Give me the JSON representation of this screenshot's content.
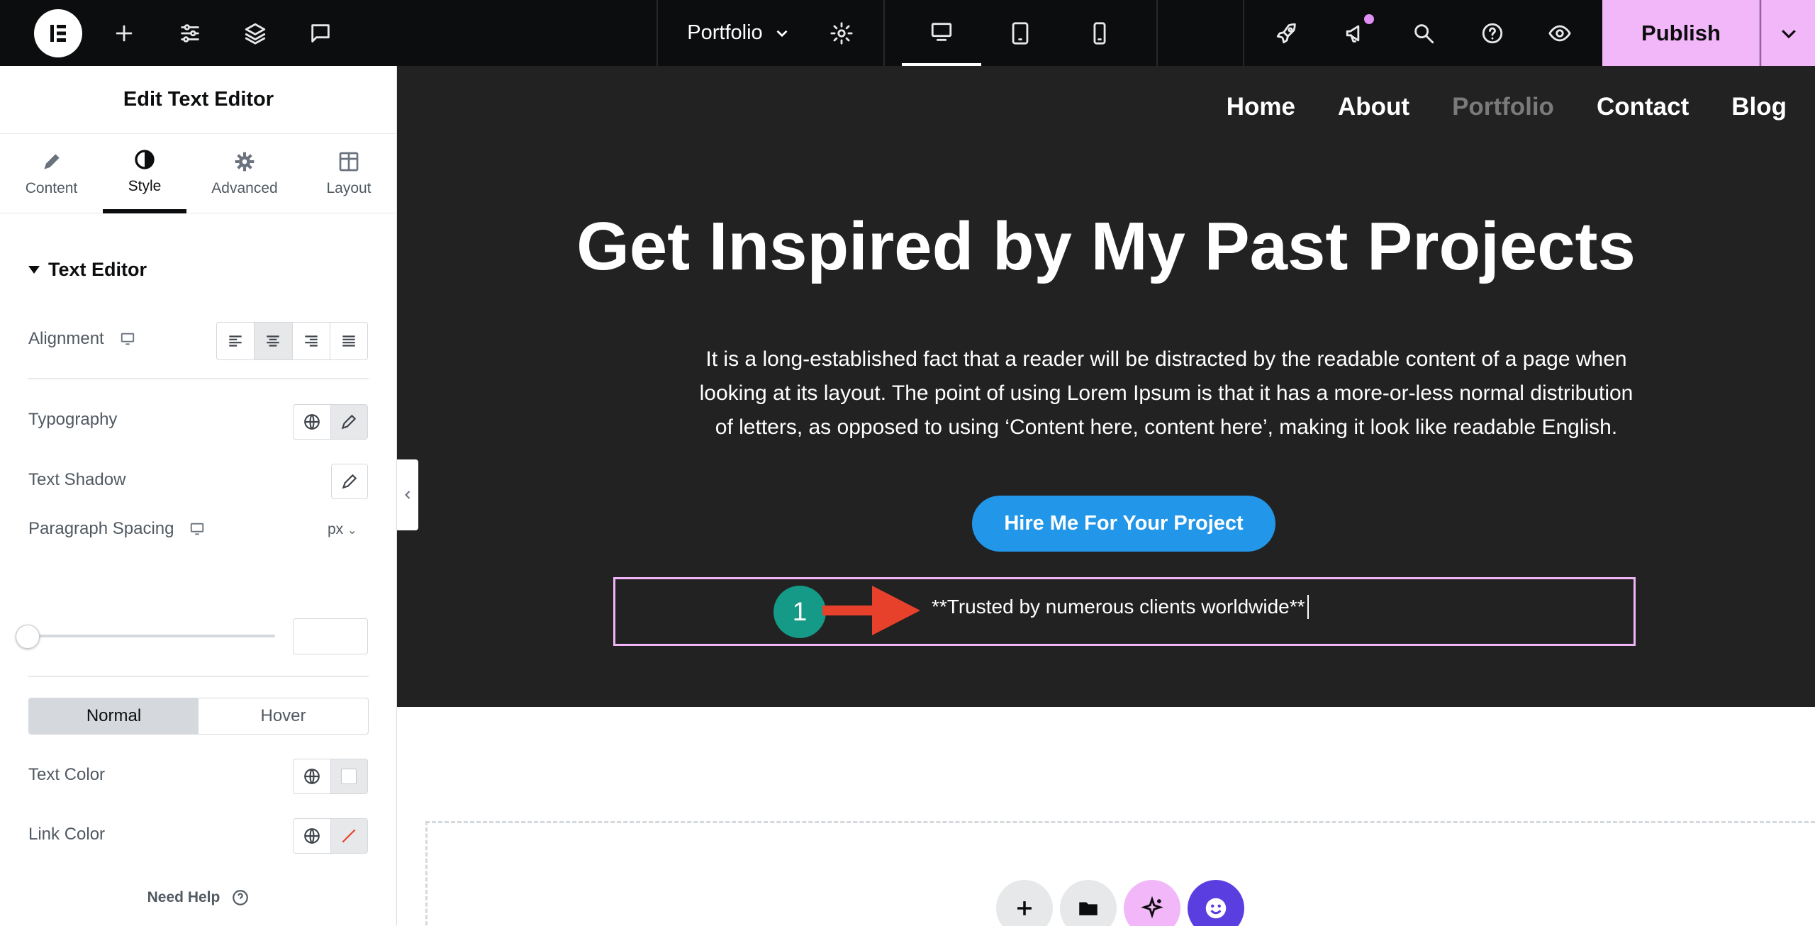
{
  "topbar": {
    "page_name": "Portfolio",
    "publish_label": "Publish"
  },
  "panel": {
    "title": "Edit Text Editor",
    "tabs": [
      {
        "label": "Content"
      },
      {
        "label": "Style"
      },
      {
        "label": "Advanced"
      },
      {
        "label": "Layout"
      }
    ],
    "section_title": "Text Editor",
    "alignment_label": "Alignment",
    "typography_label": "Typography",
    "text_shadow_label": "Text Shadow",
    "paragraph_spacing_label": "Paragraph Spacing",
    "paragraph_spacing_unit": "px",
    "paragraph_spacing_value": "",
    "state_tabs": {
      "normal": "Normal",
      "hover": "Hover"
    },
    "text_color_label": "Text Color",
    "link_color_label": "Link Color",
    "need_help": "Need Help"
  },
  "canvas": {
    "nav": {
      "home": "Home",
      "about": "About",
      "portfolio": "Portfolio",
      "contact": "Contact",
      "blog": "Blog"
    },
    "hero_title": "Get Inspired by My Past Projects",
    "hero_text_line1": "It is a long-established fact that a reader will be distracted by the readable content of a page when",
    "hero_text_line2": "looking at its layout. The point of using Lorem Ipsum is that it has a more-or-less normal distribution",
    "hero_text_line3": "of letters, as opposed to using ‘Content here, content here’, making it look like readable English.",
    "cta_label": "Hire Me For Your Project",
    "edited_text": "**Trusted by numerous clients worldwide**",
    "step_marker": "1"
  },
  "colors": {
    "accent_pink": "#f1b7f8",
    "hero_bg": "#222222",
    "cta_blue": "#2296e8",
    "marker_teal": "#159a87",
    "arrow_red": "#e8412b"
  }
}
